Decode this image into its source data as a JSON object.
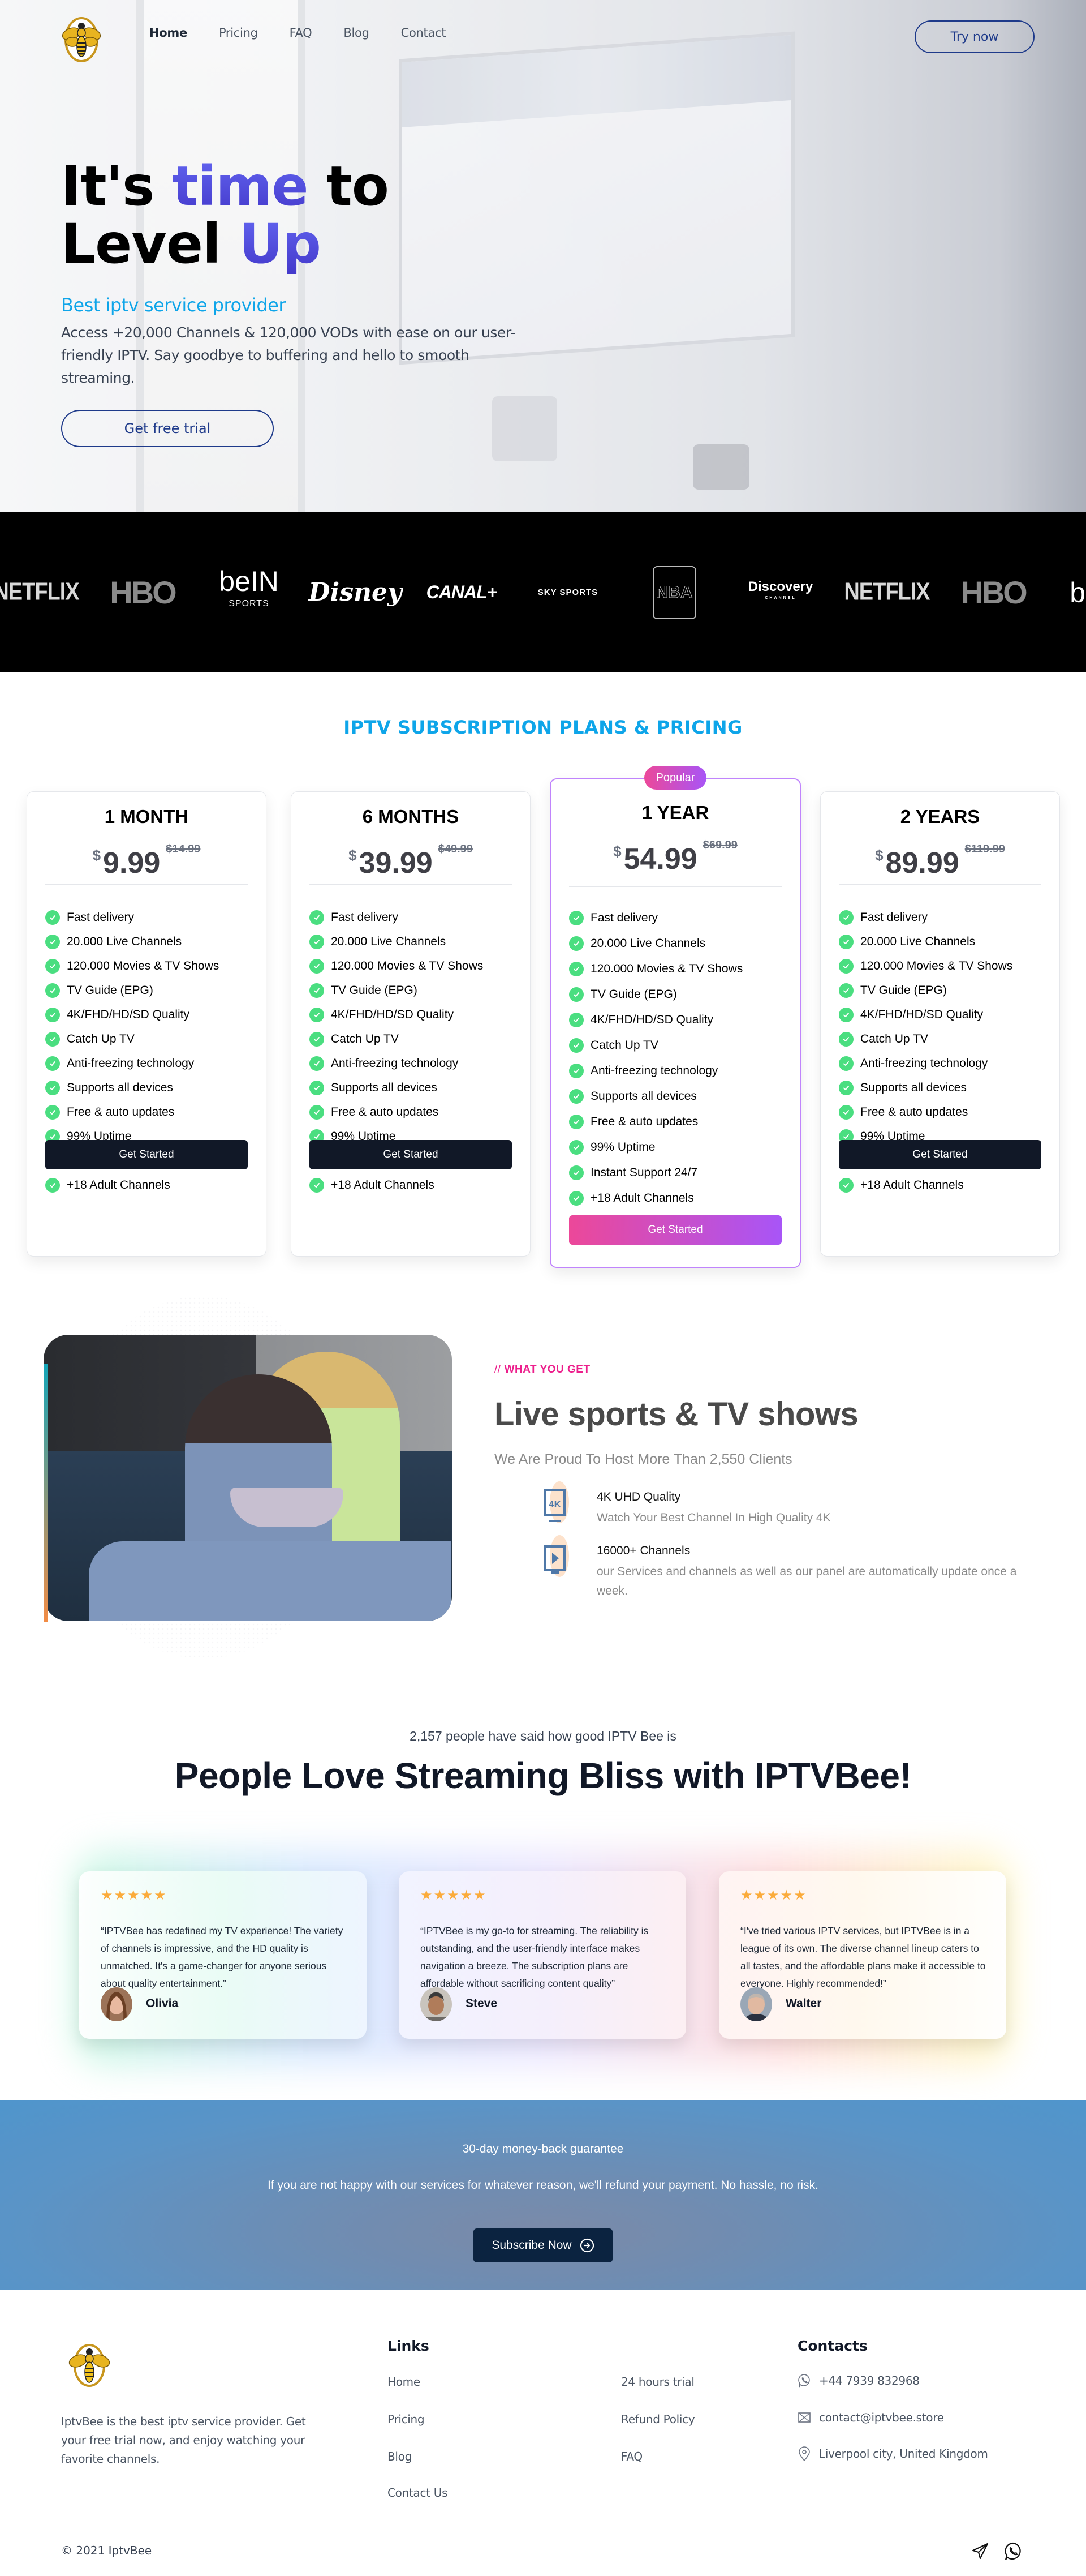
{
  "nav": {
    "brand": "IPTVBee",
    "links": [
      {
        "label": "Home",
        "active": true
      },
      {
        "label": "Pricing",
        "active": false
      },
      {
        "label": "FAQ",
        "active": false
      },
      {
        "label": "Blog",
        "active": false
      },
      {
        "label": "Contact",
        "active": false
      }
    ],
    "cta_label": "Try now"
  },
  "hero": {
    "title_line1_pre": "It's ",
    "title_line1_accent": "time",
    "title_line1_post": " to",
    "title_line2_pre": "Level ",
    "title_line2_accent": "Up",
    "subtitle": "Best iptv service provider",
    "body": "Access +20,000 Channels & 120,000 VODs with ease on our user-friendly IPTV. Say goodbye to buffering and hello to smooth streaming.",
    "button_label": "Get free trial"
  },
  "brands": [
    "NETFLIX",
    "HBO",
    "beIN SPORTS",
    "Disney",
    "CANAL+",
    "SKY SPORTS",
    "NBA",
    "Discovery CHANNEL",
    "NETFLIX",
    "HBO",
    "beIN"
  ],
  "pricing": {
    "title": "IPTV SUBSCRIPTION PLANS & PRICING",
    "currency": "$",
    "button_label": "Get Started",
    "popular_label": "Popular",
    "features": [
      "Fast delivery",
      "20.000 Live Channels",
      "120.000 Movies & TV Shows",
      "TV Guide (EPG)",
      "4K/FHD/HD/SD Quality",
      "Catch Up TV",
      "Anti-freezing technology",
      "Supports all devices",
      "Free & auto updates",
      "99% Uptime",
      "Instant Support 24/7",
      "+18 Adult Channels"
    ],
    "plans": [
      {
        "name": "1 MONTH",
        "price": "9.99",
        "old_price": "$14.99",
        "popular": false
      },
      {
        "name": "6 MONTHS",
        "price": "39.99",
        "old_price": "$49.99",
        "popular": false
      },
      {
        "name": "1 YEAR",
        "price": "54.99",
        "old_price": "$69.99",
        "popular": true
      },
      {
        "name": "2 YEARS",
        "price": "89.99",
        "old_price": "$119.99",
        "popular": false
      }
    ]
  },
  "what_you_get": {
    "eyebrow_slash": "//",
    "eyebrow": "WHAT YOU GET",
    "title": "Live sports & TV shows",
    "subtitle": "We Are Proud To Host More Than 2,550 Clients",
    "items": [
      {
        "icon": "4k-tv-icon",
        "title": "4K UHD Quality",
        "desc": "Watch Your Best Channel In High Quality 4K"
      },
      {
        "icon": "play-tv-icon",
        "title": "16000+ Channels",
        "desc": "our Services and channels as well as our panel are automatically update once a week."
      }
    ]
  },
  "testimonials": {
    "count_text": "2,157 people have said how good IPTV Bee is",
    "title": "People Love Streaming Bliss with IPTVBee!",
    "rating_stars": 5,
    "stars": "★★★★★",
    "items": [
      {
        "quote": "“IPTVBee has redefined my TV experience! The variety of channels is impressive, and the HD quality is unmatched. It's a game-changer for anyone serious about quality entertainment.”",
        "name": "Olivia"
      },
      {
        "quote": "“IPTVBee is my go-to for streaming. The reliability is outstanding, and the user-friendly interface makes navigation a breeze. The subscription plans are affordable without sacrificing content quality”",
        "name": "Steve"
      },
      {
        "quote": "“I've tried various IPTV services, but IPTVBee is in a league of its own. The diverse channel lineup caters to all tastes, and the affordable plans make it accessible to everyone. Highly recommended!”",
        "name": "Walter"
      }
    ]
  },
  "cta": {
    "title": "30-day money-back guarantee",
    "body": "If you are not happy with our services for whatever reason, we'll refund your payment. No hassle, no risk.",
    "button_label": "Subscribe Now"
  },
  "footer": {
    "description": "IptvBee is the best iptv service provider. Get your free trial now, and enjoy watching your favorite channels.",
    "links_heading": "Links",
    "links_col1": [
      "Home",
      "Pricing",
      "Blog",
      "Contact Us"
    ],
    "links_col2": [
      "24 hours trial",
      "Refund Policy",
      "FAQ"
    ],
    "contacts_heading": "Contacts",
    "phone": "+44 7939 832968",
    "email": "contact@iptvbee.store",
    "address": "Liverpool city, United Kingdom",
    "copyright_symbol": "©",
    "copyright_year": "2021",
    "copyright_name": "IptvBee"
  },
  "colors": {
    "accent_blue": "#0ea5e9",
    "accent_indigo": "#4f46e5",
    "navy": "#1e3a8a",
    "pink": "#ec4899",
    "purple": "#a855f7",
    "check_green": "#4ade80",
    "star": "#fbab3b"
  }
}
